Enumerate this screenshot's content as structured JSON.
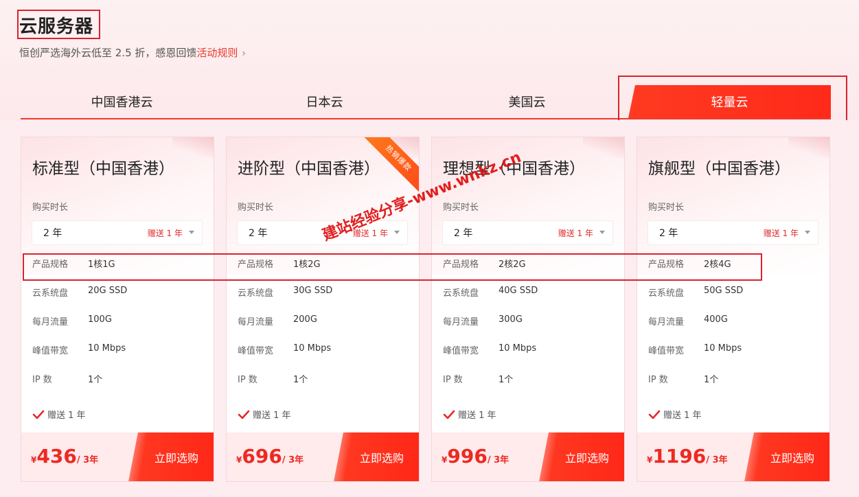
{
  "page": {
    "title": "云服务器",
    "subtitle": "恒创严选海外云低至 2.5 折，感恩回馈",
    "activity_link": "活动规则",
    "chevron": "›"
  },
  "tabs": [
    {
      "label": "中国香港云",
      "active": false
    },
    {
      "label": "日本云",
      "active": false
    },
    {
      "label": "美国云",
      "active": false
    },
    {
      "label": "轻量云",
      "active": true
    }
  ],
  "labels": {
    "duration": "购买时长",
    "spec": "产品规格",
    "disk": "云系统盘",
    "traffic": "每月流量",
    "bandwidth": "峰值带宽",
    "ip": "IP 数",
    "buy": "立即选购",
    "currency": "¥"
  },
  "ribbon": "热销爆款",
  "watermark": "建站经验分享-www.wnkz.cn",
  "cards": [
    {
      "title": "标准型（中国香港）",
      "duration": "2 年",
      "gift": "赠送 1 年",
      "spec": "1核1G",
      "disk": "20G SSD",
      "traffic": "100G",
      "bandwidth": "10 Mbps",
      "ip": "1个",
      "gift_row": "赠送 1 年",
      "price": "436",
      "unit": "/ 3年"
    },
    {
      "title": "进阶型（中国香港）",
      "duration": "2 年",
      "gift": "赠送 1 年",
      "spec": "1核2G",
      "disk": "30G SSD",
      "traffic": "200G",
      "bandwidth": "10 Mbps",
      "ip": "1个",
      "gift_row": "赠送 1 年",
      "price": "696",
      "unit": "/ 3年"
    },
    {
      "title": "理想型（中国香港）",
      "duration": "2 年",
      "gift": "赠送 1 年",
      "spec": "2核2G",
      "disk": "40G SSD",
      "traffic": "300G",
      "bandwidth": "10 Mbps",
      "ip": "1个",
      "gift_row": "赠送 1 年",
      "price": "996",
      "unit": "/ 3年"
    },
    {
      "title": "旗舰型（中国香港）",
      "duration": "2 年",
      "gift": "赠送 1 年",
      "spec": "2核4G",
      "disk": "50G SSD",
      "traffic": "400G",
      "bandwidth": "10 Mbps",
      "ip": "1个",
      "gift_row": "赠送 1 年",
      "price": "1196",
      "unit": "/ 3年"
    }
  ],
  "colors": {
    "accent": "#ff2a1a",
    "highlight_box": "#d9232c"
  }
}
